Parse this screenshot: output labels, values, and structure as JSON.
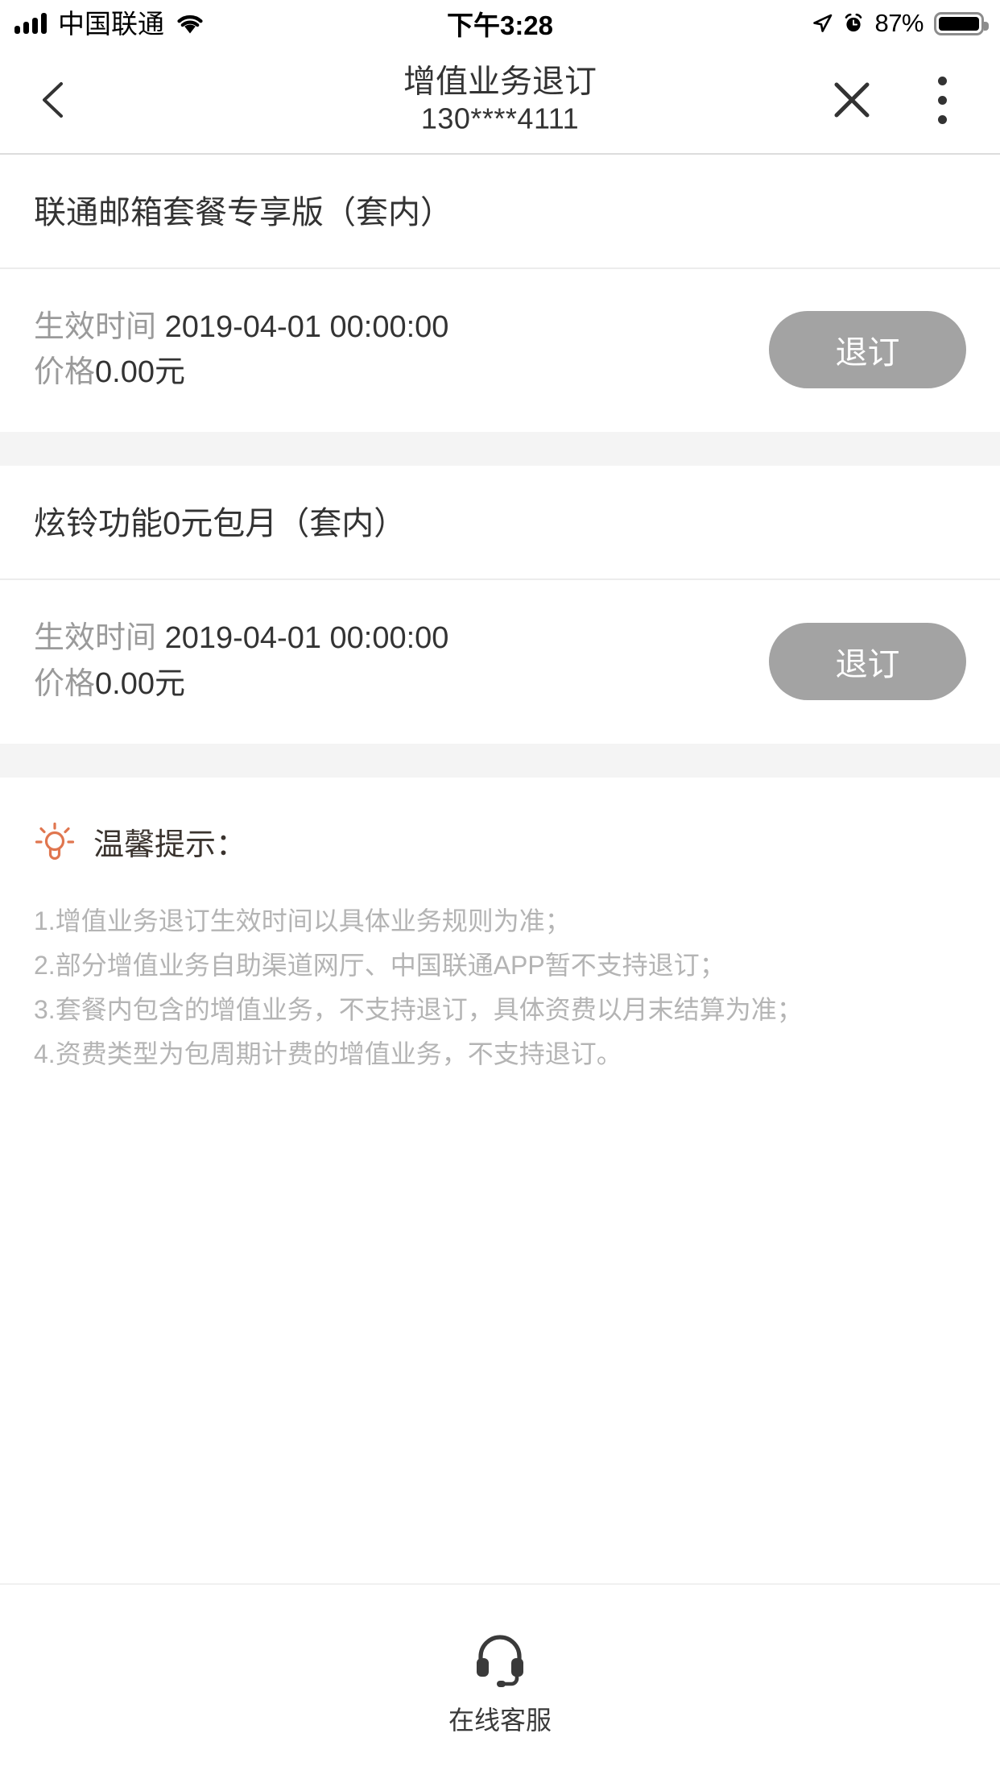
{
  "statusbar": {
    "carrier": "中国联通",
    "time": "下午3:28",
    "battery_percent": "87%",
    "icons": [
      "signal-bars-icon",
      "wifi-icon",
      "location-arrow-icon",
      "alarm-clock-icon",
      "battery-icon"
    ]
  },
  "header": {
    "title": "增值业务退订",
    "subtitle": "130****4111",
    "back_icon": "chevron-left-icon",
    "close_icon": "close-icon",
    "more_icon": "more-vertical-icon"
  },
  "services": [
    {
      "name": "联通邮箱套餐专享版（套内）",
      "effective_label": "生效时间",
      "effective_value": "2019-04-01 00:00:00",
      "price_label": "价格",
      "price_value": "0.00元",
      "button_label": "退订"
    },
    {
      "name": "炫铃功能0元包月（套内）",
      "effective_label": "生效时间",
      "effective_value": "2019-04-01 00:00:00",
      "price_label": "价格",
      "price_value": "0.00元",
      "button_label": "退订"
    }
  ],
  "tips": {
    "icon": "lightbulb-icon",
    "heading": "温馨提示：",
    "lines": [
      "1.增值业务退订生效时间以具体业务规则为准；",
      "2.部分增值业务自助渠道网厅、中国联通APP暂不支持退订；",
      "3.套餐内包含的增值业务，不支持退订，具体资费以月末结算为准；",
      "4.资费类型为包周期计费的增值业务，不支持退订。"
    ]
  },
  "bottombar": {
    "icon": "headset-icon",
    "label": "在线客服"
  },
  "colors": {
    "button_gray": "#a3a3a3",
    "tip_gray": "#b4b4b4",
    "label_gray": "#9a9a9a",
    "accent_orange": "#e0764f",
    "band_gray": "#f4f4f4"
  }
}
